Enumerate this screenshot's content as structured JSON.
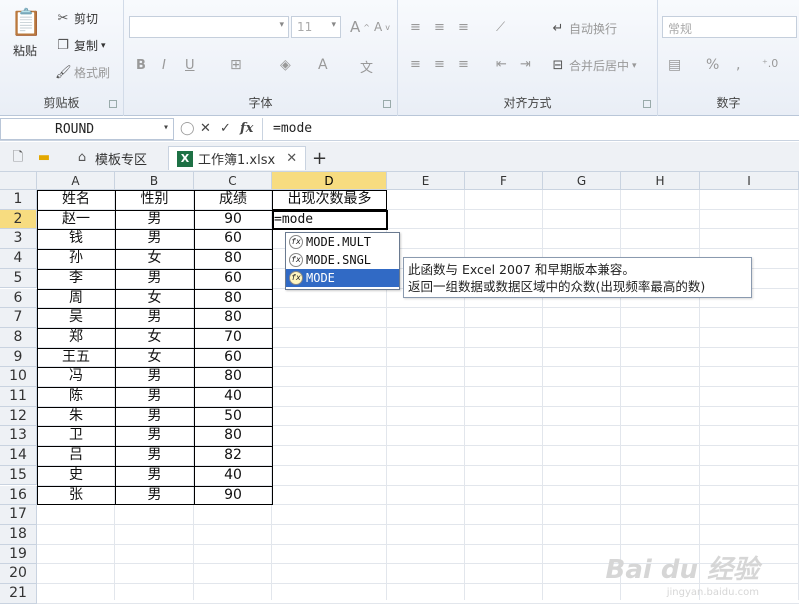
{
  "ribbon": {
    "clipboard": {
      "label": "剪贴板",
      "paste": "粘贴",
      "cut": "剪切",
      "copy": "复制",
      "format_painter": "格式刷"
    },
    "font": {
      "label": "字体",
      "size": "11",
      "bold": "B",
      "italic": "I",
      "underline": "U"
    },
    "alignment": {
      "label": "对齐方式",
      "wrap": "自动换行",
      "merge": "合并后居中"
    },
    "number": {
      "label": "数字",
      "format": "常规",
      "percent": "%",
      "comma": ","
    }
  },
  "formula_bar": {
    "name_box": "ROUND",
    "cancel": "✕",
    "confirm": "✓",
    "fx": "fx",
    "formula": "=mode"
  },
  "tabs": {
    "template": "模板专区",
    "workbook": "工作簿1.xlsx",
    "close": "✕",
    "add": "+"
  },
  "columns": [
    "A",
    "B",
    "C",
    "D",
    "E",
    "F",
    "G",
    "H",
    "I"
  ],
  "rows": [
    "1",
    "2",
    "3",
    "4",
    "5",
    "6",
    "7",
    "8",
    "9",
    "10",
    "11",
    "12",
    "13",
    "14",
    "15",
    "16",
    "17",
    "18",
    "19",
    "20",
    "21"
  ],
  "table": {
    "headers": [
      "姓名",
      "性别",
      "成绩",
      "出现次数最多"
    ],
    "data": [
      [
        "赵一",
        "男",
        "90"
      ],
      [
        "钱",
        "男",
        "60"
      ],
      [
        "孙",
        "女",
        "80"
      ],
      [
        "李",
        "男",
        "60"
      ],
      [
        "周",
        "女",
        "80"
      ],
      [
        "吴",
        "男",
        "80"
      ],
      [
        "郑",
        "女",
        "70"
      ],
      [
        "王五",
        "女",
        "60"
      ],
      [
        "冯",
        "男",
        "80"
      ],
      [
        "陈",
        "男",
        "40"
      ],
      [
        "朱",
        "男",
        "50"
      ],
      [
        "卫",
        "男",
        "80"
      ],
      [
        "吕",
        "男",
        "82"
      ],
      [
        "史",
        "男",
        "40"
      ],
      [
        "张",
        "男",
        "90"
      ]
    ],
    "editing_cell": "=mode"
  },
  "autocomplete": {
    "items": [
      "MODE.MULT",
      "MODE.SNGL",
      "MODE"
    ],
    "selected_index": 2
  },
  "tooltip": {
    "line1": "此函数与 Excel 2007 和早期版本兼容。",
    "line2": "返回一组数据或数据区域中的众数(出现频率最高的数)"
  },
  "watermark": {
    "brand": "Bai du 经验",
    "url": "jingyan.baidu.com"
  },
  "colors": {
    "accent": "#316ac5",
    "selected_header": "#f7dc80",
    "ribbon_bg": "#e9eef6"
  }
}
